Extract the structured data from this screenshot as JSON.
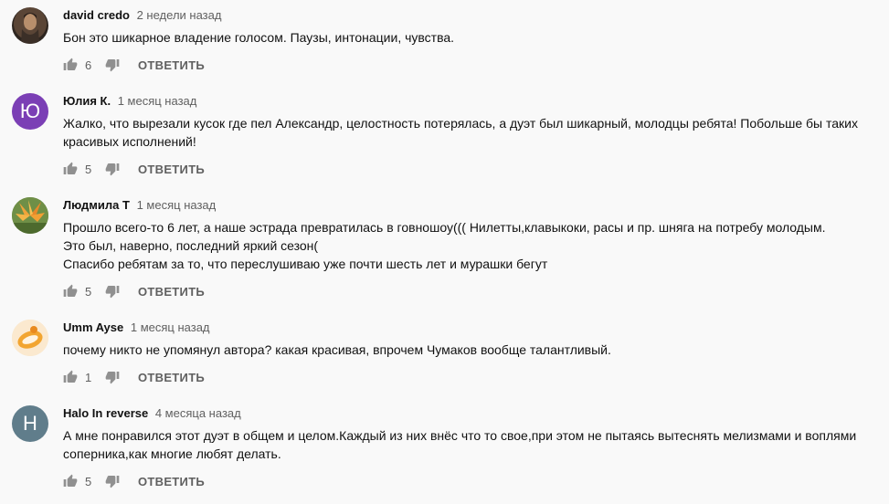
{
  "comments": [
    {
      "author": "david credo",
      "time": "2 недели назад",
      "text": "Бон это шикарное владение голосом. Паузы, интонации, чувства.",
      "likes": "6",
      "reply_label": "ОТВЕТИТЬ",
      "avatar": {
        "type": "photo",
        "color": "#6b5a4a"
      }
    },
    {
      "author": "Юлия К.",
      "time": "1 месяц назад",
      "text": "Жалко, что вырезали кусок где пел Александр, целостность потерялась, а дуэт был шикарный, молодцы ребята! Побольше бы таких красивых исполнений!",
      "likes": "5",
      "reply_label": "ОТВЕТИТЬ",
      "avatar": {
        "type": "letter",
        "letter": "Ю",
        "color": "#7b3fb5"
      }
    },
    {
      "author": "Людмила Т",
      "time": "1 месяц назад",
      "text": "Прошло всего-то 6 лет, а наше эстрада превратилась в говношоу((( Нилетты,клавыкоки, расы и пр. шняга на потребу молодым.\nЭто был, наверно, последний яркий сезон(\nСпасибо ребятам за то, что переслушиваю уже почти шесть лет и мурашки бегут",
      "likes": "5",
      "reply_label": "ОТВЕТИТЬ",
      "avatar": {
        "type": "photo",
        "color": "#e08a2c"
      }
    },
    {
      "author": "Umm Ayse",
      "time": "1 месяц назад",
      "text": "почему никто не упомянул автора?  какая красивая, впрочем Чумаков вообще талантливый.",
      "likes": "1",
      "reply_label": "ОТВЕТИТЬ",
      "avatar": {
        "type": "photo",
        "color": "#f2a531"
      }
    },
    {
      "author": "Halo In reverse",
      "time": "4 месяца назад",
      "text": "А мне понравился этот дуэт в общем и целом.Каждый из них внёс что то свое,при этом не пытаясь вытеснять мелизмами и воплями соперника,как многие любят делать.",
      "likes": "5",
      "reply_label": "ОТВЕТИТЬ",
      "avatar": {
        "type": "letter",
        "letter": "Н",
        "color": "#607d8b"
      }
    }
  ],
  "icons": {
    "like": "thumb-up-icon",
    "dislike": "thumb-down-icon"
  }
}
